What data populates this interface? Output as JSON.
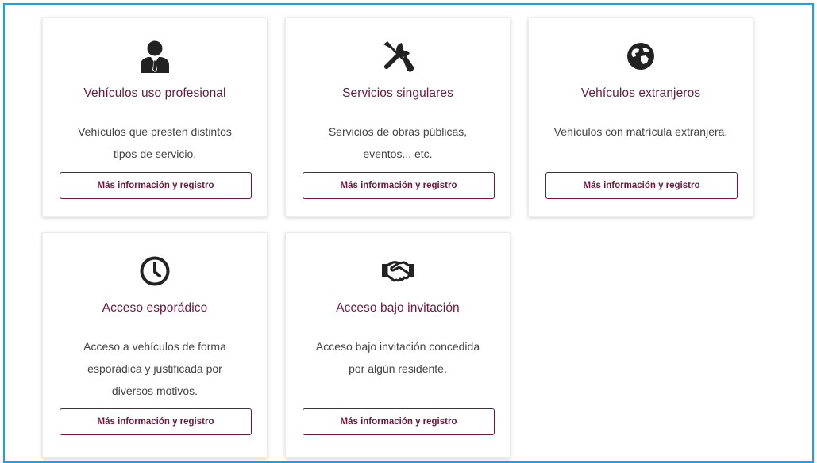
{
  "cards": [
    {
      "icon": "user-tie-icon",
      "title": "Vehículos uso profesional",
      "desc_lines": [
        "Vehículos que presten distintos",
        "tipos de servicio."
      ],
      "button": "Más información y registro"
    },
    {
      "icon": "tools-icon",
      "title": "Servicios singulares",
      "desc_lines": [
        "Servicios de obras públicas,",
        "eventos... etc."
      ],
      "button": "Más información y registro"
    },
    {
      "icon": "globe-icon",
      "title": "Vehículos extranjeros",
      "desc_lines": [
        "Vehículos con matrícula extranjera."
      ],
      "button": "Más información y registro"
    },
    {
      "icon": "clock-icon",
      "title": "Acceso esporádico",
      "desc_lines": [
        "Acceso a vehículos de forma",
        "esporádica y justificada por",
        "diversos motivos."
      ],
      "button": "Más información y registro"
    },
    {
      "icon": "handshake-icon",
      "title": "Acceso bajo invitación",
      "desc_lines": [
        "Acceso bajo invitación concedida",
        "por algún residente."
      ],
      "button": "Más información y registro"
    }
  ],
  "colors": {
    "accent": "#6b1a3b",
    "frame": "#1aa3e0",
    "icon": "#222222"
  }
}
